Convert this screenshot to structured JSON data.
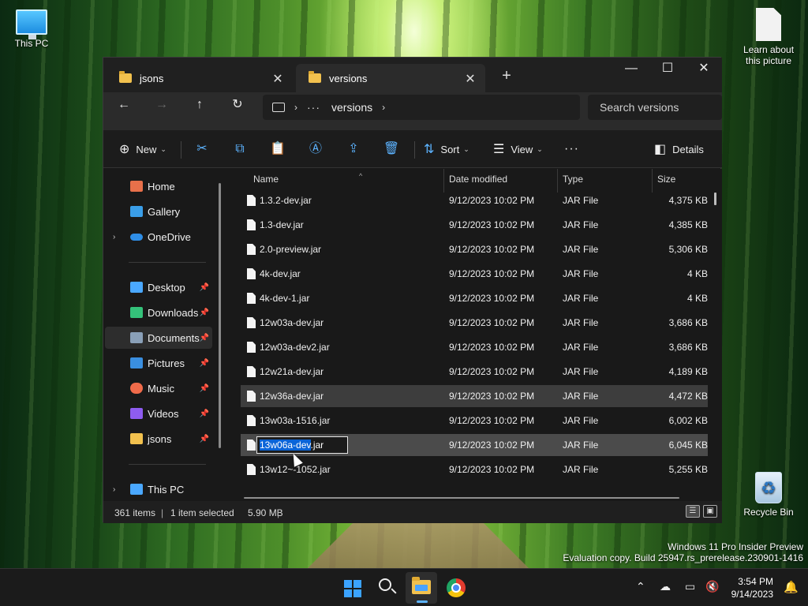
{
  "desktop": {
    "icons": [
      {
        "label": "This PC"
      },
      {
        "label": "Learn about this picture"
      },
      {
        "label": "Recycle Bin"
      }
    ],
    "watermark": {
      "line1": "Windows 11 Pro Insider Preview",
      "line2": "Evaluation copy. Build 25947.rs_prerelease.230901-1416"
    }
  },
  "window": {
    "tabs": [
      {
        "label": "jsons",
        "active": false
      },
      {
        "label": "versions",
        "active": true
      }
    ],
    "new_tab": "+",
    "controls": {
      "minimize": "—",
      "maximize": "☐",
      "close": "✕"
    },
    "nav": {
      "back": "←",
      "forward": "→",
      "up": "↑",
      "refresh": "↻",
      "breadcrumb_overflow": "···",
      "breadcrumb_current": "versions",
      "search_placeholder": "Search versions"
    },
    "commands": {
      "new": "New",
      "sort": "Sort",
      "view": "View",
      "more": "···",
      "details": "Details"
    },
    "sidebar": {
      "items": [
        {
          "label": "Home",
          "icon": "home-icon",
          "color": "#e8704a"
        },
        {
          "label": "Gallery",
          "icon": "gallery-icon",
          "color": "#3a9ee8"
        },
        {
          "label": "OneDrive",
          "icon": "cloud-icon",
          "color": "#2f8ee6"
        },
        {
          "label": "Desktop",
          "icon": "desktop-icon",
          "color": "#4aa8ff"
        },
        {
          "label": "Downloads",
          "icon": "download-icon",
          "color": "#34c27a"
        },
        {
          "label": "Documents",
          "icon": "document-icon",
          "color": "#8aa0b8"
        },
        {
          "label": "Pictures",
          "icon": "pictures-icon",
          "color": "#3a8fe0"
        },
        {
          "label": "Music",
          "icon": "music-icon",
          "color": "#f06b4a"
        },
        {
          "label": "Videos",
          "icon": "videos-icon",
          "color": "#8e5cf0"
        },
        {
          "label": "jsons",
          "icon": "folder-icon",
          "color": "#f2c14e"
        },
        {
          "label": "This PC",
          "icon": "computer-icon",
          "color": "#4aa8ff"
        }
      ],
      "selected": "Documents"
    },
    "columns": {
      "name": "Name",
      "date": "Date modified",
      "type": "Type",
      "size": "Size"
    },
    "files": [
      {
        "name": "1.3.2-dev.jar",
        "date": "9/12/2023 10:02 PM",
        "type": "JAR File",
        "size": "4,375 KB"
      },
      {
        "name": "1.3-dev.jar",
        "date": "9/12/2023 10:02 PM",
        "type": "JAR File",
        "size": "4,385 KB"
      },
      {
        "name": "2.0-preview.jar",
        "date": "9/12/2023 10:02 PM",
        "type": "JAR File",
        "size": "5,306 KB"
      },
      {
        "name": "4k-dev.jar",
        "date": "9/12/2023 10:02 PM",
        "type": "JAR File",
        "size": "4 KB"
      },
      {
        "name": "4k-dev-1.jar",
        "date": "9/12/2023 10:02 PM",
        "type": "JAR File",
        "size": "4 KB"
      },
      {
        "name": "12w03a-dev.jar",
        "date": "9/12/2023 10:02 PM",
        "type": "JAR File",
        "size": "3,686 KB"
      },
      {
        "name": "12w03a-dev2.jar",
        "date": "9/12/2023 10:02 PM",
        "type": "JAR File",
        "size": "3,686 KB"
      },
      {
        "name": "12w21a-dev.jar",
        "date": "9/12/2023 10:02 PM",
        "type": "JAR File",
        "size": "4,189 KB"
      },
      {
        "name": "12w36a-dev.jar",
        "date": "9/12/2023 10:02 PM",
        "type": "JAR File",
        "size": "4,472 KB"
      },
      {
        "name": "13w03a-1516.jar",
        "date": "9/12/2023 10:02 PM",
        "type": "JAR File",
        "size": "6,002 KB"
      },
      {
        "name": "13w06a-dev.jar",
        "date": "9/12/2023 10:02 PM",
        "type": "JAR File",
        "size": "6,045 KB"
      },
      {
        "name": "13w12~-1052.jar",
        "date": "9/12/2023 10:02 PM",
        "type": "JAR File",
        "size": "5,255 KB"
      }
    ],
    "rename": {
      "selected_part": "13w06a-dev",
      "extension": ".jar"
    },
    "status": {
      "count": "361 items",
      "selection": "1 item selected",
      "size": "5.90 MB"
    }
  },
  "taskbar": {
    "clock_time": "3:54 PM",
    "clock_date": "9/14/2023"
  },
  "colors": {
    "accent": "#5cb3ff",
    "selection": "#0a64d8"
  }
}
